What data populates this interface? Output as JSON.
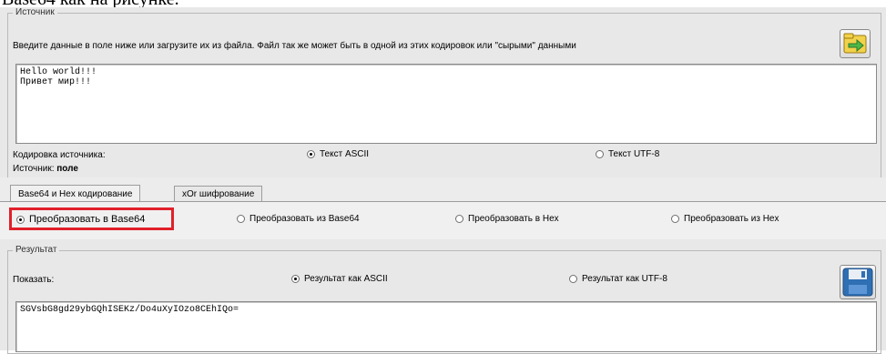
{
  "doc_fragment": "Base64 как на рисунке.",
  "source": {
    "legend": "Источник",
    "instruction": "Введите данные в поле ниже или загрузите их из файла. Файл так же может быть в одной из этих кодировок или \"сырыми\" данными",
    "input_text": "Hello world!!!\nПривет мир!!!",
    "encoding_label": "Кодировка источника:",
    "encoding_options": [
      "Текст ASCII",
      "Текст UTF-8"
    ],
    "encoding_selected": "Текст ASCII",
    "source_prefix": "Источник:",
    "source_value": "поле",
    "load_icon": "folder-load-icon"
  },
  "tabs": [
    "Base64 и Hex кодирование",
    "xOr шифрование"
  ],
  "active_tab": "Base64 и Hex кодирование",
  "operations": {
    "options": [
      "Преобразовать в Base64",
      "Преобразовать из Base64",
      "Преобразовать в Hex",
      "Преобразовать из Hex"
    ],
    "selected": "Преобразовать в Base64",
    "highlight_color": "#e0202a"
  },
  "result": {
    "legend": "Результат",
    "show_label": "Показать:",
    "options": [
      "Результат как ASCII",
      "Результат как UTF-8"
    ],
    "selected": "Результат как ASCII",
    "output_text": "SGVsbG8gd29ybGQhISEKz/Do4uXyIOzo8CEhIQo=",
    "save_icon": "floppy-save-icon"
  }
}
